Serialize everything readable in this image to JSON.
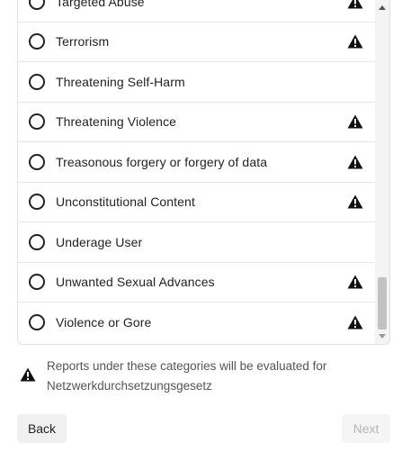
{
  "categories": [
    {
      "label": "Targeted Abuse",
      "warning": true
    },
    {
      "label": "Terrorism",
      "warning": true
    },
    {
      "label": "Threatening Self-Harm",
      "warning": false
    },
    {
      "label": "Threatening Violence",
      "warning": true
    },
    {
      "label": "Treasonous forgery or forgery of data",
      "warning": true
    },
    {
      "label": "Unconstitutional Content",
      "warning": true
    },
    {
      "label": "Underage User",
      "warning": false
    },
    {
      "label": "Unwanted Sexual Advances",
      "warning": true
    },
    {
      "label": "Violence or Gore",
      "warning": true
    }
  ],
  "notice": {
    "text": "Reports under these categories will be evaluated for Netzwerkdurchsetzungsgesetz",
    "icon": "warning-icon"
  },
  "buttons": {
    "back_label": "Back",
    "next_label": "Next"
  },
  "colors": {
    "text": "#222222",
    "border": "#e6e6e6",
    "disabled": "#b5b5b5"
  }
}
